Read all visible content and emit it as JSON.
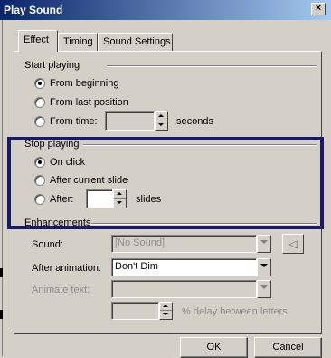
{
  "window": {
    "title": "Play Sound",
    "close_glyph": "×"
  },
  "tabs": [
    {
      "label": "Effect",
      "active": true
    },
    {
      "label": "Timing",
      "active": false
    },
    {
      "label": "Sound Settings",
      "active": false
    }
  ],
  "start_playing": {
    "header": "Start playing",
    "options": [
      {
        "label": "From beginning",
        "selected": true
      },
      {
        "label": "From last position",
        "selected": false
      },
      {
        "label": "From time:",
        "selected": false
      }
    ],
    "time_value": "",
    "time_unit": "seconds"
  },
  "stop_playing": {
    "header": "Stop playing",
    "options": [
      {
        "label": "On click",
        "selected": true
      },
      {
        "label": "After current slide",
        "selected": false
      },
      {
        "label": "After:",
        "selected": false
      }
    ],
    "slides_value": "",
    "slides_unit": "slides"
  },
  "enhancements": {
    "header": "Enhancements",
    "sound_label": "Sound:",
    "sound_value": "[No Sound]",
    "after_animation_label": "After animation:",
    "after_animation_value": "Don't Dim",
    "animate_text_label": "Animate text:",
    "animate_text_value": "",
    "delay_value": "",
    "delay_label": "% delay between letters"
  },
  "buttons": {
    "ok": "OK",
    "cancel": "Cancel"
  },
  "colors": {
    "highlight_border": "#1a1a64",
    "titlebar_start": "#0a246a",
    "titlebar_end": "#a6caf0"
  }
}
